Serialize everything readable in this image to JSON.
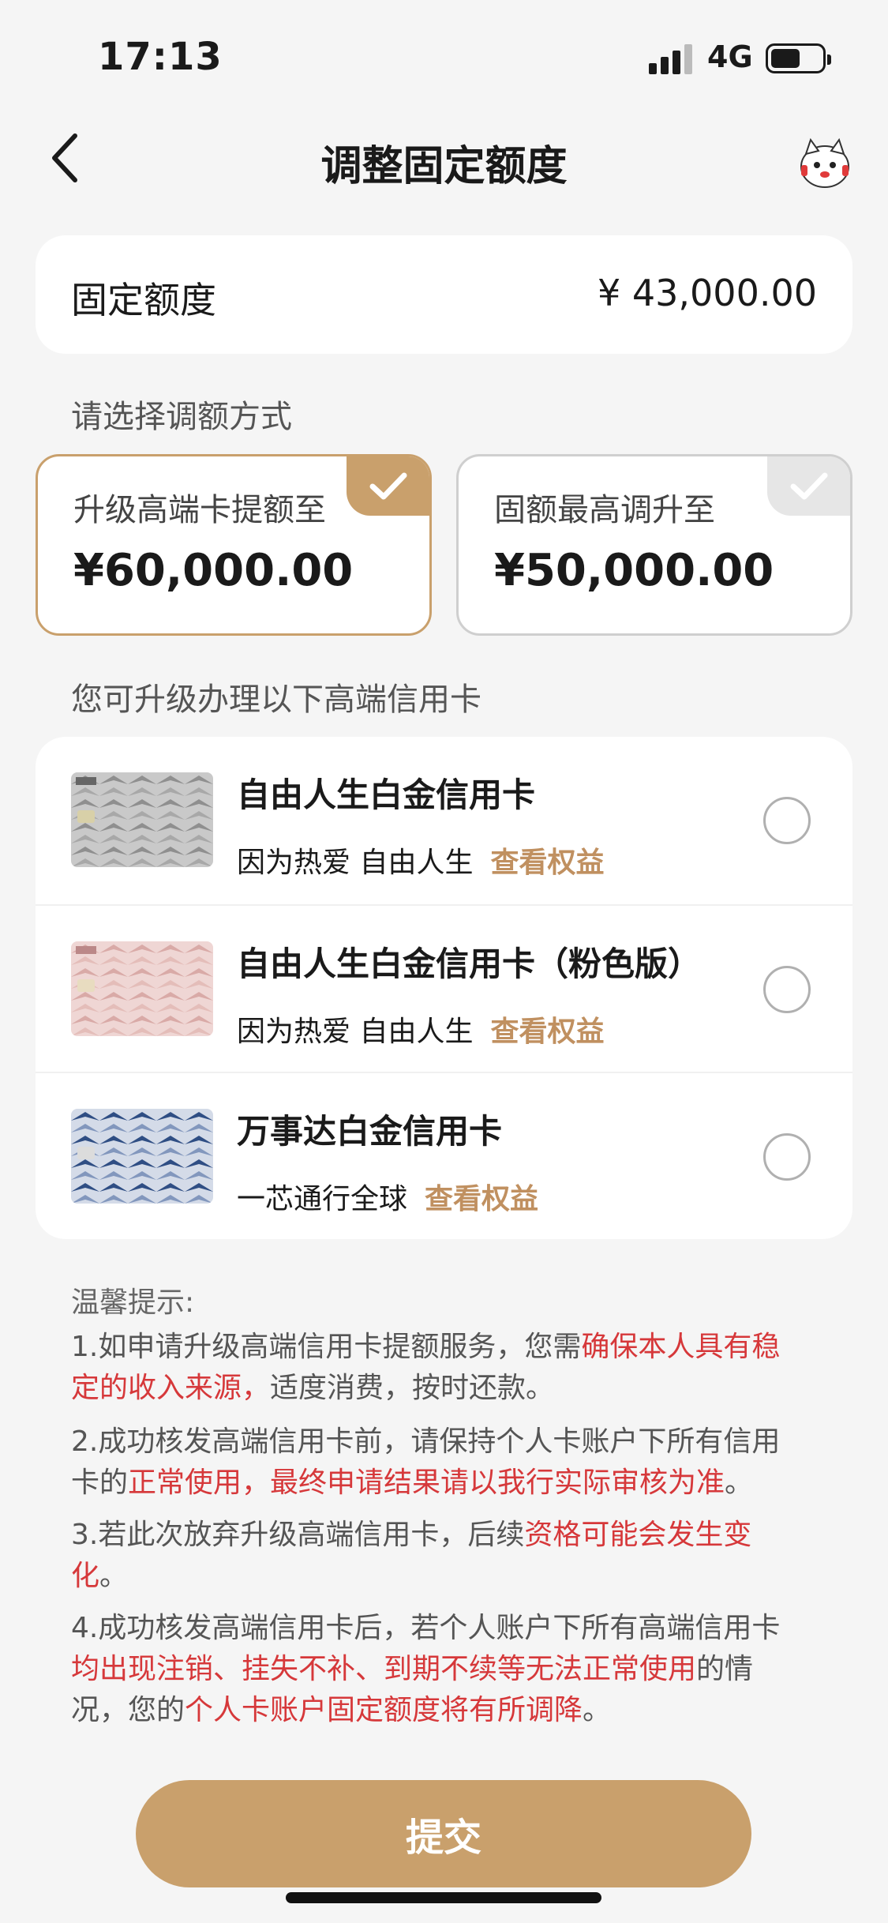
{
  "status_bar": {
    "time": "17:13",
    "network": "4G",
    "battery_level": 0.58
  },
  "nav": {
    "title": "调整固定额度",
    "back_icon": "chevron-left-icon",
    "mascot_icon": "mascot-icon"
  },
  "limit": {
    "label": "固定额度",
    "value": "¥ 43,000.00"
  },
  "select_title": "请选择调额方式",
  "options": [
    {
      "label": "升级高端卡提额至",
      "value": "¥60,000.00",
      "selected": true
    },
    {
      "label": "固额最高调升至",
      "value": "¥50,000.00",
      "selected": false
    }
  ],
  "cards_title": "您可升级办理以下高端信用卡",
  "cards": [
    {
      "name": "自由人生白金信用卡",
      "desc": "因为热爱 自由人生",
      "link": "查看权益"
    },
    {
      "name": "自由人生白金信用卡（粉色版）",
      "desc": "因为热爱 自由人生",
      "link": "查看权益"
    },
    {
      "name": "万事达白金信用卡",
      "desc": "一芯通行全球",
      "link": "查看权益"
    }
  ],
  "tips": {
    "title": "温馨提示:",
    "t1": {
      "a": "1.如申请升级高端信用卡提额服务，您需",
      "b": "确保本人具有稳定的收入来源，",
      "c": "适度消费，按时还款。"
    },
    "t2": {
      "a": "2.成功核发高端信用卡前，请保持个人卡账户下所有信用卡的",
      "b": "正常使用，最终申请结果请以我行实际审核为准",
      "c": "。"
    },
    "t3": {
      "a": "3.若此次放弃升级高端信用卡，后续",
      "b": "资格可能会发生变化",
      "c": "。"
    },
    "t4": {
      "a": "4.成功核发高端信用卡后，若个人账户下所有高端信用卡",
      "b": "均出现注销、挂失不补、到期不续等无法正常使用",
      "c": "的情况，您的",
      "d": "个人卡账户固定额度将有所调降",
      "e": "。"
    }
  },
  "submit_label": "提交",
  "colors": {
    "accent": "#c9a06c",
    "warning": "#d6383a",
    "background": "#f5f5f5"
  }
}
